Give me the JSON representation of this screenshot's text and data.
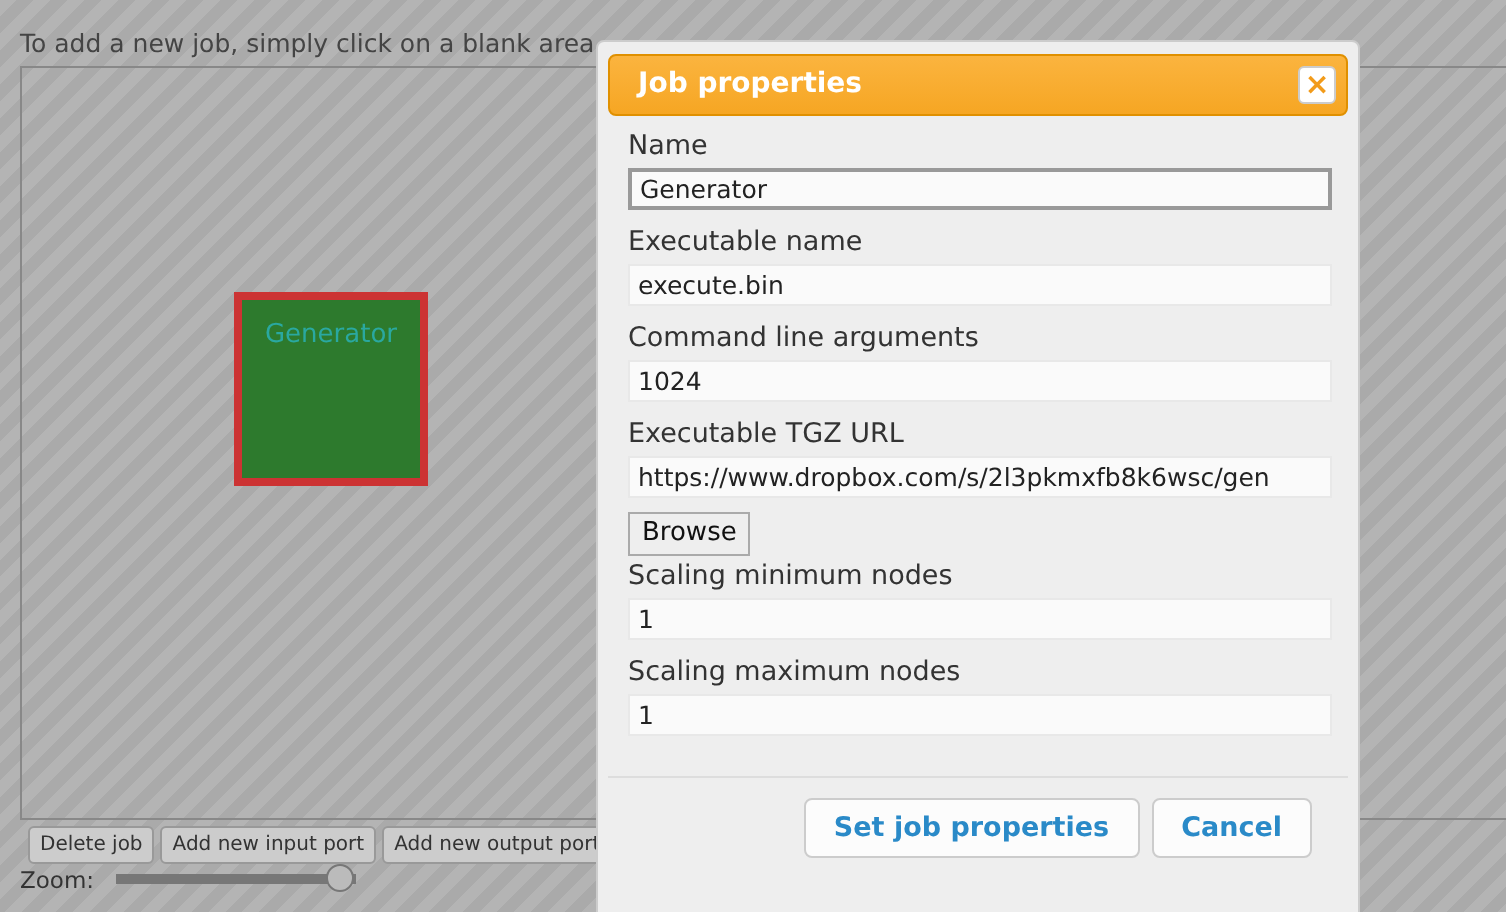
{
  "instructions": "To add a new job, simply click on a blank area",
  "canvas": {
    "jobs": [
      {
        "label": "Generator",
        "selected": true
      }
    ]
  },
  "toolbar": [
    "Delete job",
    "Add new input port",
    "Add new output port"
  ],
  "zoom": {
    "label": "Zoom:",
    "level": 0.93
  },
  "dialog": {
    "title": "Job properties",
    "close": "×",
    "items": [
      {
        "kind": "field",
        "label": "Name",
        "value": "Generator",
        "focused": true
      },
      {
        "kind": "field",
        "label": "Executable name",
        "value": "execute.bin",
        "focused": false
      },
      {
        "kind": "field",
        "label": "Command line arguments",
        "value": "1024",
        "focused": false
      },
      {
        "kind": "field",
        "label": "Executable TGZ URL",
        "value": "https://www.dropbox.com/s/2l3pkmxfb8k6wsc/gen",
        "focused": false
      },
      {
        "kind": "button",
        "label": "Browse"
      },
      {
        "kind": "field",
        "label": "Scaling minimum nodes",
        "value": "1",
        "focused": false
      },
      {
        "kind": "field",
        "label": "Scaling maximum nodes",
        "value": "1",
        "focused": false
      }
    ],
    "buttons": [
      "Set job properties",
      "Cancel"
    ]
  }
}
